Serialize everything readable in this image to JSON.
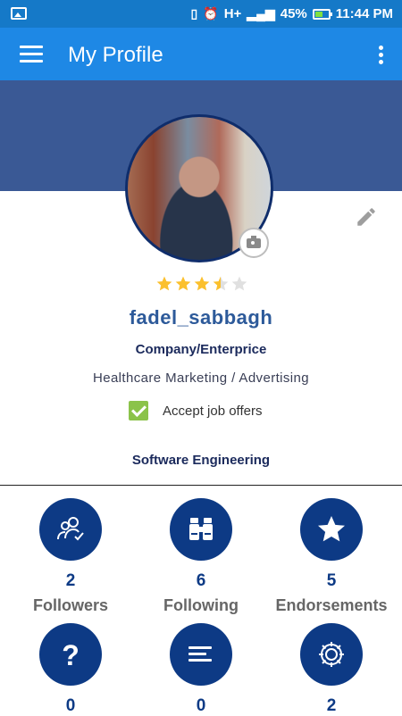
{
  "status_bar": {
    "network": "H+",
    "battery": "45%",
    "time": "11:44 PM"
  },
  "app_bar": {
    "title": "My Profile"
  },
  "profile": {
    "username": "fadel_sabbagh",
    "rating": 3.5,
    "rating_max": 5,
    "account_type": "Company/Enterprice",
    "industry": "Healthcare Marketing / Advertising",
    "accept_jobs_label": "Accept job offers",
    "accept_jobs_checked": true,
    "specialty": "Software Engineering"
  },
  "stats": [
    {
      "icon": "followers-icon",
      "count": "2",
      "label": "Followers"
    },
    {
      "icon": "binoculars-icon",
      "count": "6",
      "label": "Following"
    },
    {
      "icon": "star-icon",
      "count": "5",
      "label": "Endorsements"
    },
    {
      "icon": "question-icon",
      "count": "0",
      "label": ""
    },
    {
      "icon": "lines-icon",
      "count": "0",
      "label": ""
    },
    {
      "icon": "gear-icon",
      "count": "2",
      "label": ""
    }
  ],
  "colors": {
    "status_bar": "#1579c8",
    "app_bar": "#1e88e5",
    "banner": "#3a5995",
    "stat_circle": "#0d3a85",
    "star_filled": "#fbc02d",
    "star_empty": "#e0e0e0",
    "checkbox": "#8bc34a"
  }
}
